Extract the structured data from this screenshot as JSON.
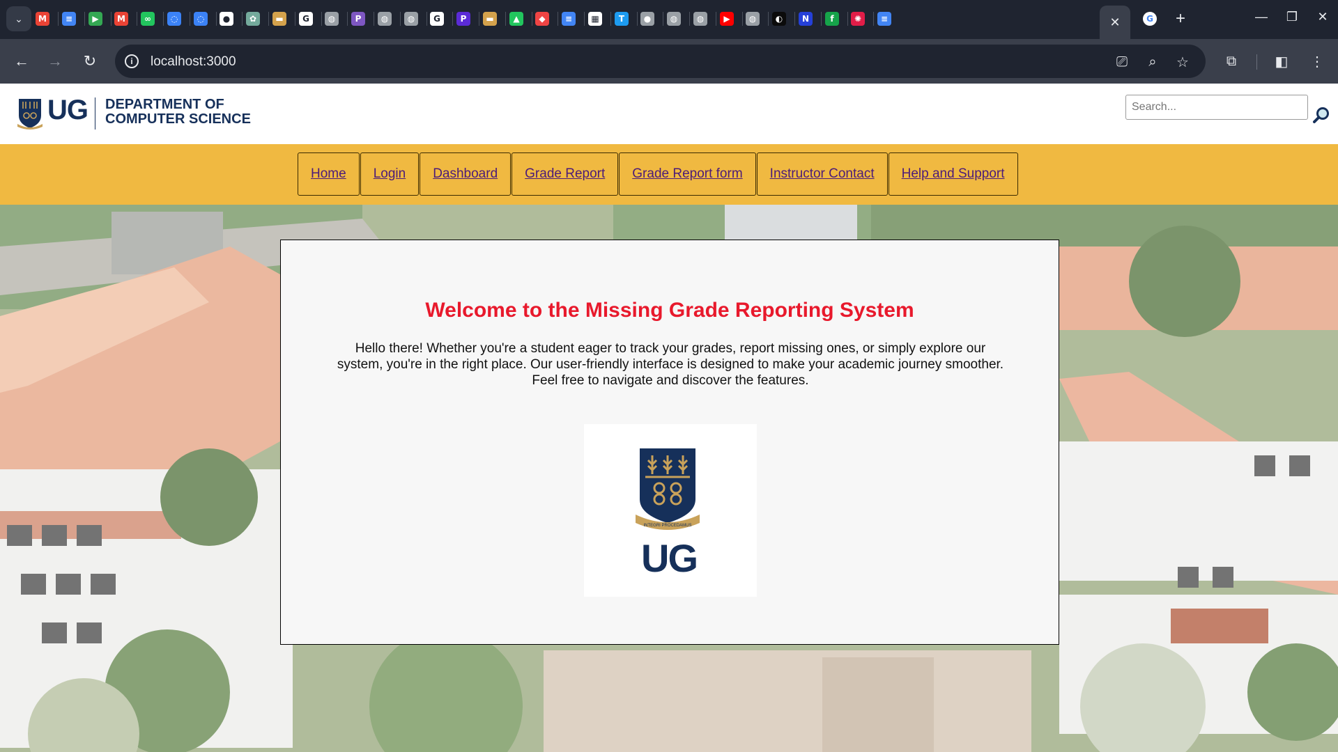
{
  "browser": {
    "url": "localhost:3000",
    "tabs": [
      {
        "icon": "gmail-icon",
        "color": "#ea4335",
        "glyph": "M"
      },
      {
        "icon": "google-docs-icon",
        "color": "#4285f4",
        "glyph": "≡"
      },
      {
        "icon": "google-play-icon",
        "color": "#34a853",
        "glyph": "▶"
      },
      {
        "icon": "gmail-icon",
        "color": "#ea4335",
        "glyph": "M"
      },
      {
        "icon": "glasses-icon",
        "color": "#22c55e",
        "glyph": "∞"
      },
      {
        "icon": "ring-icon",
        "color": "#3b82f6",
        "glyph": "◌"
      },
      {
        "icon": "ring-icon",
        "color": "#3b82f6",
        "glyph": "◌"
      },
      {
        "icon": "github-icon",
        "color": "#ffffff",
        "glyph": "●"
      },
      {
        "icon": "chatgpt-icon",
        "color": "#74aa9c",
        "glyph": "✿"
      },
      {
        "icon": "folder-icon",
        "color": "#d4a24c",
        "glyph": "▬"
      },
      {
        "icon": "google-icon",
        "color": "#ffffff",
        "glyph": "G"
      },
      {
        "icon": "globe-icon",
        "color": "#9aa0a6",
        "glyph": "◍"
      },
      {
        "icon": "p-icon",
        "color": "#7e57c2",
        "glyph": "P"
      },
      {
        "icon": "globe-icon",
        "color": "#9aa0a6",
        "glyph": "◍"
      },
      {
        "icon": "globe-icon",
        "color": "#9aa0a6",
        "glyph": "◍"
      },
      {
        "icon": "google-icon",
        "color": "#ffffff",
        "glyph": "G"
      },
      {
        "icon": "p-icon",
        "color": "#5b2bd6",
        "glyph": "P"
      },
      {
        "icon": "folder-icon",
        "color": "#d4a24c",
        "glyph": "▬"
      },
      {
        "icon": "mountain-icon",
        "color": "#22c55e",
        "glyph": "▲"
      },
      {
        "icon": "tag-icon",
        "color": "#ef4444",
        "glyph": "◆"
      },
      {
        "icon": "google-docs-icon",
        "color": "#4285f4",
        "glyph": "≡"
      },
      {
        "icon": "news-icon",
        "color": "#ffffff",
        "glyph": "▦"
      },
      {
        "icon": "tt-icon",
        "color": "#1d9bf0",
        "glyph": "T"
      },
      {
        "icon": "apple-icon",
        "color": "#9aa0a6",
        "glyph": "●"
      },
      {
        "icon": "globe-icon",
        "color": "#9aa0a6",
        "glyph": "◍"
      },
      {
        "icon": "globe-icon",
        "color": "#9aa0a6",
        "glyph": "◍"
      },
      {
        "icon": "youtube-icon",
        "color": "#ff0000",
        "glyph": "▶"
      },
      {
        "icon": "globe-icon",
        "color": "#9aa0a6",
        "glyph": "◍"
      },
      {
        "icon": "speed-icon",
        "color": "#0b0b0b",
        "glyph": "◐"
      },
      {
        "icon": "n-icon",
        "color": "#2540d8",
        "glyph": "N"
      },
      {
        "icon": "f-icon",
        "color": "#16a34a",
        "glyph": "f"
      },
      {
        "icon": "flower-icon",
        "color": "#e11d48",
        "glyph": "✺"
      },
      {
        "icon": "google-docs-icon",
        "color": "#4285f4",
        "glyph": "≡"
      }
    ],
    "active_tab_icon": "close-icon",
    "after_active_tab_icon": "google-icon"
  },
  "site": {
    "logo_text": "UG",
    "department_line1": "DEPARTMENT OF",
    "department_line2": "COMPUTER SCIENCE",
    "search_placeholder": "Search...",
    "nav": [
      {
        "label": "Home"
      },
      {
        "label": "Login"
      },
      {
        "label": "Dashboard"
      },
      {
        "label": "Grade Report"
      },
      {
        "label": "Grade Report form"
      },
      {
        "label": "Instructor Contact"
      },
      {
        "label": "Help and Support"
      }
    ]
  },
  "main": {
    "title": "Welcome to the Missing Grade Reporting System",
    "intro": "Hello there! Whether you're a student eager to track your grades, report missing ones, or simply explore our system, you're in the right place. Our user-friendly interface is designed to make your academic journey smoother. Feel free to navigate and discover the features.",
    "logo_text": "UG",
    "crest_motto": "INTEGRI PROCEDAMUS"
  },
  "colors": {
    "nav_bar": "#f0b941",
    "brand_navy": "#16305a",
    "brand_gold": "#c9a25a",
    "title_red": "#e8192c",
    "link_purple": "#4b1b79"
  }
}
